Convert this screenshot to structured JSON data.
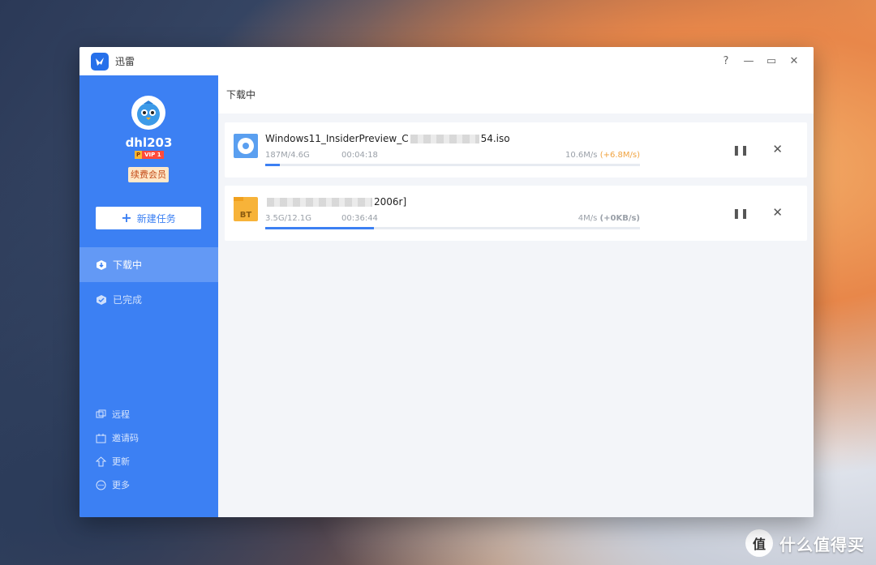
{
  "window": {
    "title": "迅雷"
  },
  "controls": {
    "help": "?",
    "minimize": "—",
    "maximize": "▭",
    "close": "✕"
  },
  "user": {
    "name": "dhl203",
    "vip_p": "P",
    "vip_level": "VIP 1",
    "renew_label": "续费会员"
  },
  "sidebar": {
    "new_task_label": "新建任务",
    "nav": [
      {
        "label": "下载中"
      },
      {
        "label": "已完成"
      }
    ],
    "bottom": [
      {
        "label": "远程"
      },
      {
        "label": "邀请码"
      },
      {
        "label": "更新"
      },
      {
        "label": "更多"
      }
    ]
  },
  "main": {
    "header_title": "下载中"
  },
  "tasks": [
    {
      "name_prefix": "Windows11_InsiderPreview_C",
      "name_suffix": "54.iso",
      "progress_text": "187M/4.6G",
      "time_left": "00:04:18",
      "speed": "10.6M/s",
      "boost": "(+6.8M/s)",
      "progress_fraction": 0.04
    },
    {
      "name_prefix": "",
      "name_suffix": "2006r]",
      "progress_text": "3.5G/12.1G",
      "time_left": "00:36:44",
      "speed": "4M/s",
      "boost": "(+0KB/s)",
      "progress_fraction": 0.29
    }
  ],
  "watermark": {
    "logo": "值",
    "text": "什么值得买"
  },
  "colors": {
    "accent": "#3c80f3",
    "boost": "#f0a340",
    "renew_text": "#c34a17"
  }
}
